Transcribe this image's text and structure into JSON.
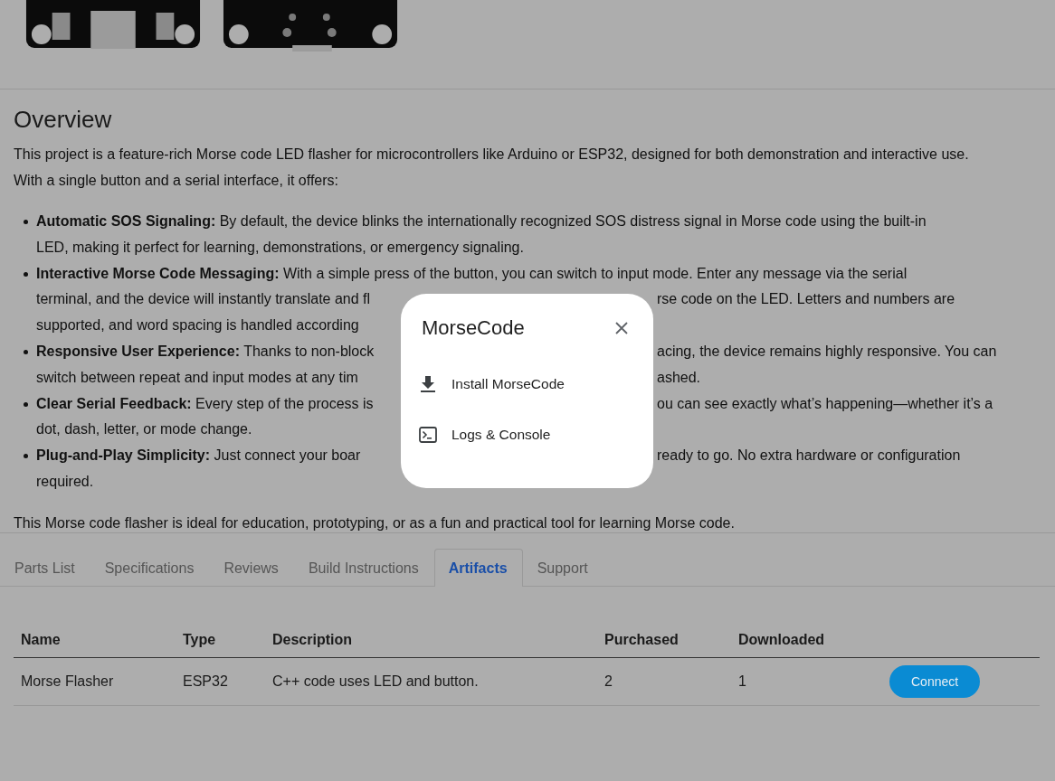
{
  "overview": {
    "title": "Overview",
    "intro": "This project is a feature-rich Morse code LED flasher for microcontrollers like Arduino or ESP32, designed for both demonstration and interactive use. With a single button and a serial interface, it offers:",
    "bullets": [
      {
        "lines": [
          [
            "**Automatic SOS Signaling:** By default, the device blinks the internationally recognized SOS distress signal in Morse code using the built-in"
          ],
          [
            "LED, making it perfect for learning, demonstrations, or emergency signaling."
          ]
        ]
      },
      {
        "lines": [
          [
            "**Interactive Morse Code Messaging:** With a simple press of the button, you can switch to input mode. Enter any message via the serial"
          ],
          [
            "terminal, and the device will instantly translate and fl",
            "rse code on the LED. Letters and numbers are"
          ],
          [
            "supported, and word spacing is handled according"
          ]
        ]
      },
      {
        "lines": [
          [
            "**Responsive User Experience:** Thanks to non-block",
            "acing, the device remains highly responsive. You can"
          ],
          [
            "switch between repeat and input modes at any tim",
            "ashed."
          ]
        ]
      },
      {
        "lines": [
          [
            "**Clear Serial Feedback:** Every step of the process is",
            "ou can see exactly what’s happening—whether it’s a"
          ],
          [
            "dot, dash, letter, or mode change."
          ]
        ]
      },
      {
        "lines": [
          [
            "**Plug-and-Play Simplicity:** Just connect your boar",
            "ready to go. No extra hardware or configuration"
          ],
          [
            "required."
          ]
        ]
      }
    ],
    "closing": "This Morse code flasher is ideal for education, prototyping, or as a fun and practical tool for learning Morse code."
  },
  "tabs": [
    {
      "label": "Parts List",
      "selected": false
    },
    {
      "label": "Specifications",
      "selected": false
    },
    {
      "label": "Reviews",
      "selected": false
    },
    {
      "label": "Build Instructions",
      "selected": false
    },
    {
      "label": "Artifacts",
      "selected": true
    },
    {
      "label": "Support",
      "selected": false
    }
  ],
  "table": {
    "columns": [
      "Name",
      "Type",
      "Description",
      "Purchased",
      "Downloaded"
    ],
    "rows": [
      {
        "cells": [
          "Morse Flasher",
          "ESP32",
          "C++ code uses LED and button.",
          "2",
          "1"
        ],
        "action": "Connect"
      }
    ]
  },
  "dialog": {
    "title": "MorseCode",
    "items": [
      {
        "kind": "download",
        "label": "Install MorseCode"
      },
      {
        "kind": "terminal",
        "label": "Logs & Console"
      }
    ]
  }
}
